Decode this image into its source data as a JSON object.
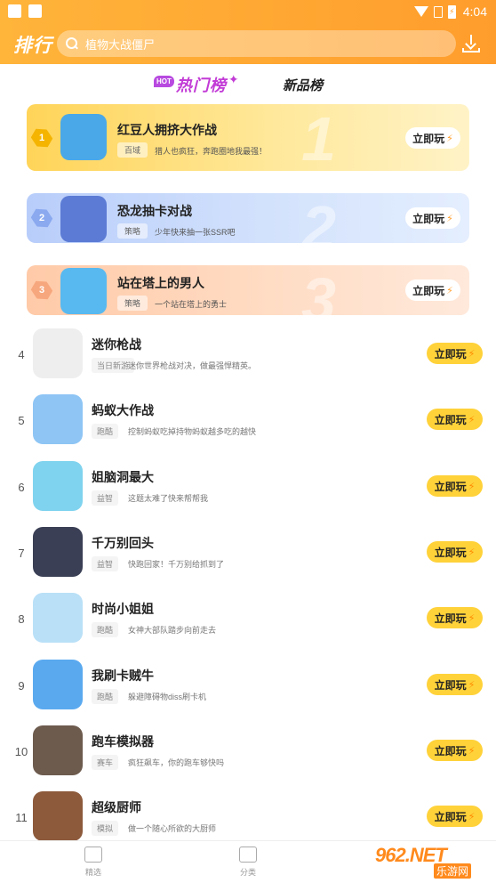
{
  "status_bar": {
    "time": "4:04",
    "battery_glyph": "⚡"
  },
  "header": {
    "title": "排行",
    "search_placeholder": "植物大战僵尸",
    "icons": {
      "search": "search-icon",
      "download": "download-icon"
    }
  },
  "tabs": {
    "hot_badge": "HOT",
    "hot_label": "热门榜",
    "new_label": "新品榜"
  },
  "play_label": "立即玩",
  "bolt_glyph": "⚡",
  "top3": [
    {
      "rank": "1",
      "name": "红豆人拥挤大作战",
      "tag": "百域",
      "desc": "猎人也疯狂，奔跑圈地我最强！",
      "icon_color": "#4aa8e8"
    },
    {
      "rank": "2",
      "name": "恐龙抽卡对战",
      "tag": "策略",
      "desc": "少年快来抽一张SSR吧",
      "icon_color": "#5b7bd5"
    },
    {
      "rank": "3",
      "name": "站在塔上的男人",
      "tag": "策略",
      "desc": "一个站在塔上的勇士",
      "icon_color": "#58b9f0"
    }
  ],
  "list": [
    {
      "rank": "4",
      "name": "迷你枪战",
      "tag": "当日新游",
      "desc": "迷你世界枪战对决，做最强悍精英。",
      "icon_color": "#eeeeee"
    },
    {
      "rank": "5",
      "name": "蚂蚁大作战",
      "tag": "跑酷",
      "desc": "控制蚂蚁吃掉持物蚂蚁越多吃的越快",
      "icon_color": "#8ec5f5"
    },
    {
      "rank": "6",
      "name": "姐脑洞最大",
      "tag": "益智",
      "desc": "这题太难了快来帮帮我",
      "icon_color": "#7fd3ee"
    },
    {
      "rank": "7",
      "name": "千万别回头",
      "tag": "益智",
      "desc": "快跑回家！千万别给抓到了",
      "icon_color": "#3a3f55"
    },
    {
      "rank": "8",
      "name": "时尚小姐姐",
      "tag": "跑酷",
      "desc": "女神大部队踏步向前走去",
      "icon_color": "#b9e0f7"
    },
    {
      "rank": "9",
      "name": "我刷卡贼牛",
      "tag": "跑酷",
      "desc": "躲避障碍物diss刷卡机",
      "icon_color": "#5aa9ef"
    },
    {
      "rank": "10",
      "name": "跑车模拟器",
      "tag": "赛车",
      "desc": "疯狂飙车，你的跑车够快吗",
      "icon_color": "#6d5b4e"
    },
    {
      "rank": "11",
      "name": "超级厨师",
      "tag": "模拟",
      "desc": "做一个随心所欲的大厨师",
      "icon_color": "#8d5a3c"
    }
  ],
  "bottom_nav": [
    {
      "label": "精选",
      "icon": "gamepad-icon"
    },
    {
      "label": "分类",
      "icon": "folder-icon"
    }
  ],
  "watermark": {
    "main": "962.NET",
    "sub": "乐游网"
  },
  "colors": {
    "header_orange": "#ffa833",
    "play_button_yellow": "#ffd23a",
    "hot_purple": "#c23bd6"
  }
}
